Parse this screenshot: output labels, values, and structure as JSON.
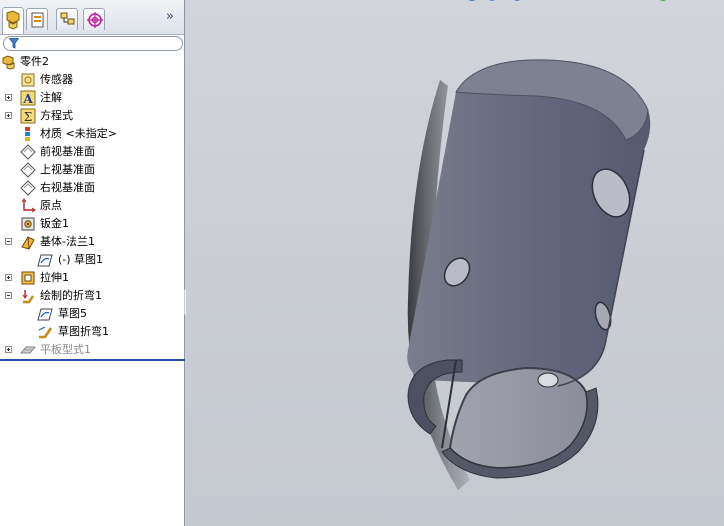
{
  "app": {
    "accent": "#2b4fa5"
  },
  "panel": {
    "tabs": [
      {
        "name": "feature-manager",
        "icon": "feature-tree-icon"
      },
      {
        "name": "property-manager",
        "icon": "property-manager-icon"
      },
      {
        "name": "configuration-manager",
        "icon": "configuration-icon"
      },
      {
        "name": "dimxpert-manager",
        "icon": "crosshair-target-icon"
      }
    ],
    "expand_more": "»",
    "filter": {
      "placeholder": "",
      "icon": "funnel-filter-icon"
    }
  },
  "tree": {
    "root": "零件2",
    "items": [
      {
        "label": "传感器",
        "icon": "sensor-icon",
        "expander": "none"
      },
      {
        "label": "注解",
        "icon": "annotation-icon",
        "expander": "plus"
      },
      {
        "label": "方程式",
        "icon": "equation-icon",
        "expander": "plus"
      },
      {
        "label": "材质 <未指定>",
        "icon": "material-icon",
        "expander": "none"
      },
      {
        "label": "前视基准面",
        "icon": "plane-icon",
        "expander": "none"
      },
      {
        "label": "上视基准面",
        "icon": "plane-icon",
        "expander": "none"
      },
      {
        "label": "右视基准面",
        "icon": "plane-icon",
        "expander": "none"
      },
      {
        "label": "原点",
        "icon": "origin-icon",
        "expander": "none"
      },
      {
        "label": "钣金1",
        "icon": "sheet-metal-icon",
        "expander": "none"
      },
      {
        "label": "基体-法兰1",
        "icon": "base-flange-icon",
        "expander": "minus"
      },
      {
        "label": "(-) 草图1",
        "icon": "sketch-icon",
        "expander": "none",
        "child": true
      },
      {
        "label": "拉伸1",
        "icon": "extrude-icon",
        "expander": "plus"
      },
      {
        "label": "绘制的折弯1",
        "icon": "sketched-bend-icon",
        "expander": "minus"
      },
      {
        "label": "草图5",
        "icon": "sketch-icon",
        "expander": "none",
        "child": true
      },
      {
        "label": "草图折弯1",
        "icon": "bend-icon",
        "expander": "none",
        "child": true
      },
      {
        "label": "平板型式1",
        "icon": "flat-pattern-icon",
        "expander": "plus",
        "suppressed": true
      }
    ]
  },
  "viewport": {
    "background": "#c9cdd4",
    "model_color": "#6b6f7e",
    "model_dark": "#3d4049",
    "model_light": "#9fa2ae"
  }
}
